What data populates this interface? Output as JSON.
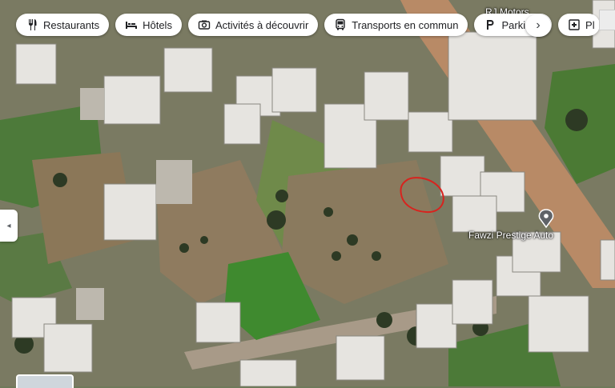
{
  "search_chips": [
    {
      "label": "Restaurants",
      "icon": "fork-knife-icon"
    },
    {
      "label": "Hôtels",
      "icon": "bed-icon"
    },
    {
      "label": "Activités à découvrir",
      "icon": "camera-icon"
    },
    {
      "label": "Transports en commun",
      "icon": "bus-icon"
    },
    {
      "label": "Parkings",
      "icon": "parking-icon"
    },
    {
      "label": "Pl",
      "icon": "pharmacy-icon"
    }
  ],
  "next_button": "›",
  "side_handle": "◂",
  "places": {
    "top_label": "RJ Motors",
    "poi_label": "Fawzi Prestige Auto"
  },
  "colors": {
    "annotation_circle": "#d8231e",
    "pin": "#5f6368",
    "road": "#b88a66",
    "field_green": "#3f8a2f"
  }
}
